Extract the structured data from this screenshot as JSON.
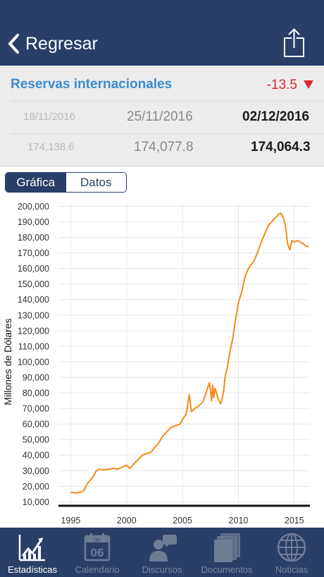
{
  "navbar": {
    "back_label": "Regresar",
    "back_icon": "chevron-left-icon",
    "share_icon": "share-icon"
  },
  "summary": {
    "indicator_name": "Reservas internacionales",
    "change": "-13.5",
    "change_color": "#e0252b",
    "change_icon": "down-triangle-icon",
    "dates": [
      "18/11/2016",
      "25/11/2016",
      "02/12/2016"
    ],
    "values": [
      "174,138.6",
      "174,077.8",
      "174,064.3"
    ]
  },
  "segmented": {
    "chart_label": "Gráfica",
    "data_label": "Datos",
    "selected": "Gráfica"
  },
  "chart_data": {
    "type": "line",
    "ylabel": "Millones de Dólares",
    "xlabel": "",
    "title": "",
    "ylim": [
      7000,
      202000
    ],
    "xlim": [
      1993.9,
      2016.4
    ],
    "y_ticks": [
      "10,000",
      "20,000",
      "30,000",
      "40,000",
      "50,000",
      "60,000",
      "70,000",
      "80,000",
      "90,000",
      "100,000",
      "110,000",
      "120,000",
      "130,000",
      "140,000",
      "150,000",
      "160,000",
      "170,000",
      "180,000",
      "190,000",
      "200,000"
    ],
    "x_ticks": [
      "1995",
      "2000",
      "2005",
      "2010",
      "2015"
    ],
    "grid": true,
    "line_color": "#f28b17",
    "series": [
      {
        "x": [
          1995.0,
          1995.5,
          1995.9,
          1996.2,
          1996.5,
          1996.9,
          1997.3,
          1997.6,
          1998.0,
          1998.4,
          1998.8,
          1999.2,
          1999.5,
          1999.8,
          2000.0,
          2000.3,
          2000.6,
          2001.0,
          2001.4,
          2001.8,
          2002.2,
          2002.5,
          2002.8,
          2003.2,
          2003.6,
          2004.0,
          2004.4,
          2004.8,
          2005.0,
          2005.3,
          2005.5,
          2005.6,
          2005.8,
          2006.1,
          2006.5,
          2006.8,
          2007.0,
          2007.2,
          2007.4,
          2007.5,
          2007.6,
          2007.7,
          2007.8,
          2007.9,
          2008.0,
          2008.2,
          2008.4,
          2008.6,
          2008.7,
          2008.8,
          2009.0,
          2009.2,
          2009.5,
          2009.7,
          2010.0,
          2010.3,
          2010.6,
          2010.9,
          2011.1,
          2011.4,
          2011.7,
          2012.0,
          2012.4,
          2012.7,
          2013.0,
          2013.2,
          2013.4,
          2013.6,
          2013.8,
          2014.0,
          2014.2,
          2014.4,
          2014.6,
          2014.8,
          2015.0,
          2015.3,
          2015.5,
          2015.8,
          2016.0,
          2016.2,
          2016.3
        ],
        "y": [
          16000,
          15800,
          16200,
          17500,
          22000,
          25000,
          30000,
          31000,
          30500,
          31000,
          31500,
          31000,
          32000,
          33000,
          33500,
          31500,
          34000,
          37000,
          40000,
          41000,
          42000,
          45000,
          47000,
          52000,
          55000,
          58000,
          59000,
          60000,
          63000,
          66000,
          74000,
          79000,
          68000,
          70000,
          72000,
          74000,
          78000,
          82000,
          86500,
          82000,
          75000,
          85000,
          77000,
          83000,
          81000,
          76000,
          73000,
          78000,
          82000,
          90000,
          96000,
          105000,
          115000,
          125000,
          138000,
          145000,
          155000,
          160000,
          162000,
          165000,
          170000,
          176000,
          183000,
          188000,
          190000,
          192000,
          193000,
          195000,
          195500,
          193000,
          188000,
          176000,
          172000,
          178000,
          177000,
          178000,
          177000,
          176000,
          174500,
          174100,
          174064
        ]
      }
    ]
  },
  "tabbar": {
    "items": [
      {
        "label": "Estadísticas",
        "icon": "chart-icon",
        "active": true
      },
      {
        "label": "Calendario",
        "icon": "calendar-icon",
        "calendar_month": "Dic",
        "calendar_day": "06",
        "active": false
      },
      {
        "label": "Discursos",
        "icon": "speech-icon",
        "active": false
      },
      {
        "label": "Documentos",
        "icon": "documents-icon",
        "active": false
      },
      {
        "label": "Noticias",
        "icon": "globe-icon",
        "active": false
      }
    ]
  }
}
